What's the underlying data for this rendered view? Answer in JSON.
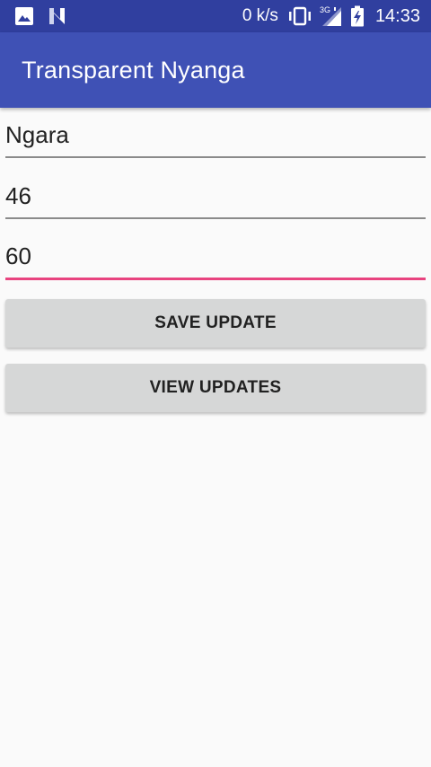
{
  "status_bar": {
    "left_icons": [
      "image-icon",
      "n-notification-icon"
    ],
    "net_speed": "0 k/s",
    "network_type": "3G",
    "time": "14:33",
    "right_icons": [
      "vibrate-icon",
      "signal-3g-icon",
      "battery-charging-icon"
    ]
  },
  "app_bar": {
    "title": "Transparent Nyanga",
    "color": "#3f51b5",
    "status_color": "#303f9f"
  },
  "form": {
    "field1_value": "Ngara",
    "field2_value": "46",
    "field3_value": "60",
    "focused_field": "field3",
    "accent_color": "#e8437f"
  },
  "buttons": {
    "save_label": "SAVE UPDATE",
    "view_label": "VIEW UPDATES"
  }
}
